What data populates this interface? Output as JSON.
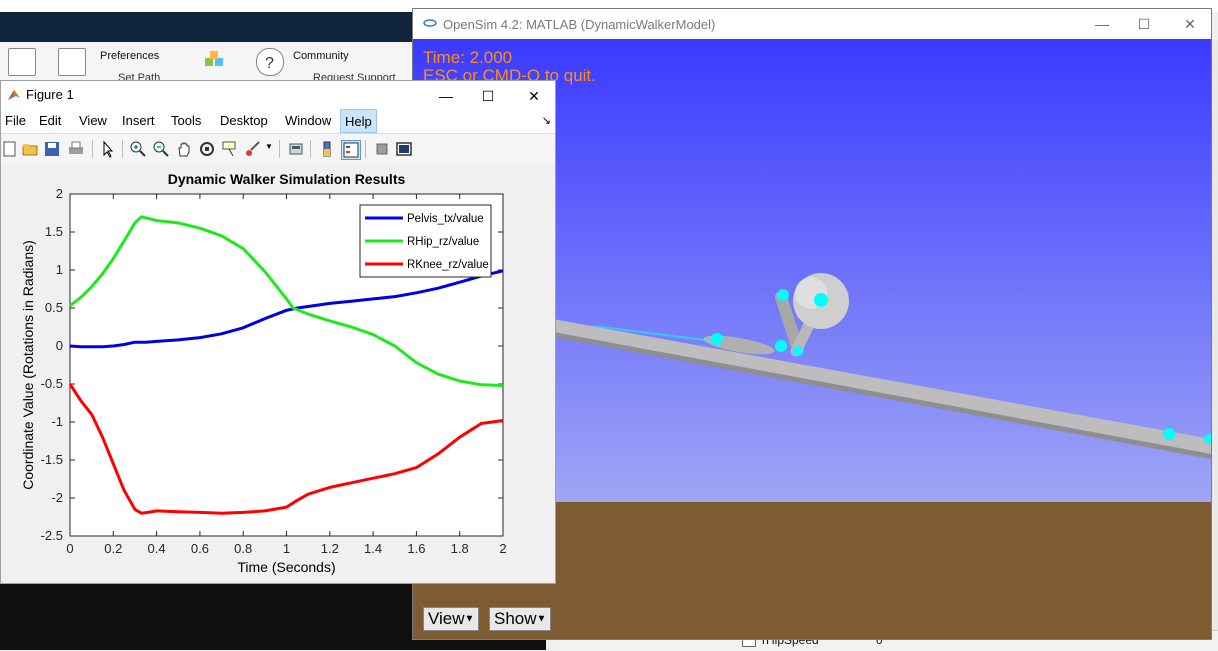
{
  "matlab_ribbon": {
    "preferences": "Preferences",
    "community": "Community",
    "set_path": "Set Path",
    "request_support": "Request Support"
  },
  "workspace": {
    "var_name": "rHipSpeed",
    "var_value": "0"
  },
  "opensim": {
    "title": "OpenSim 4.2: MATLAB (DynamicWalkerModel)",
    "time_text": "Time:  2.000",
    "quit_text": "ESC or CMD-Q to quit.",
    "view_button": "View",
    "show_button": "Show",
    "colors": {
      "sky_top": "#3a3aff",
      "ground": "#7d5c32",
      "marker": "#00ffff",
      "overlay_text": "#ff8c1a"
    }
  },
  "figure": {
    "title": "Figure 1",
    "menu": [
      "File",
      "Edit",
      "View",
      "Insert",
      "Tools",
      "Desktop",
      "Window",
      "Help"
    ],
    "active_menu": "Help",
    "toolbar_icons": [
      "new-file-icon",
      "open-file-icon",
      "save-icon",
      "print-icon",
      "select-arrow-icon",
      "zoom-in-icon",
      "zoom-out-icon",
      "pan-icon",
      "rotate-icon",
      "data-cursor-icon",
      "brush-icon",
      "link-icon",
      "colorbar-icon",
      "legend-icon",
      "hide-plot-tools-icon",
      "show-plot-tools-icon"
    ]
  },
  "chart_data": {
    "type": "line",
    "title": "Dynamic Walker Simulation Results",
    "xlabel": "Time (Seconds)",
    "ylabel": "Coordinate Value (Rotations in Radians)",
    "xlim": [
      0,
      2
    ],
    "ylim": [
      -2.5,
      2
    ],
    "xticks": [
      "0",
      "0.2",
      "0.4",
      "0.6",
      "0.8",
      "1",
      "1.2",
      "1.4",
      "1.6",
      "1.8",
      "2"
    ],
    "yticks": [
      "2",
      "1.5",
      "1",
      "0.5",
      "0",
      "-0.5",
      "-1",
      "-1.5",
      "-2",
      "-2.5"
    ],
    "legend_position": "top-right",
    "grid": false,
    "series": [
      {
        "name": "Pelvis_tx/value",
        "color": "#0000e6",
        "x": [
          0,
          0.05,
          0.1,
          0.15,
          0.2,
          0.25,
          0.3,
          0.35,
          0.4,
          0.5,
          0.6,
          0.7,
          0.8,
          0.9,
          1.0,
          1.05,
          1.1,
          1.2,
          1.3,
          1.4,
          1.5,
          1.6,
          1.7,
          1.8,
          1.9,
          2.0
        ],
        "y": [
          0.0,
          -0.01,
          -0.01,
          -0.01,
          0.0,
          0.02,
          0.05,
          0.05,
          0.06,
          0.08,
          0.11,
          0.16,
          0.24,
          0.36,
          0.47,
          0.5,
          0.52,
          0.56,
          0.59,
          0.62,
          0.65,
          0.7,
          0.76,
          0.84,
          0.92,
          0.99
        ]
      },
      {
        "name": "RHip_rz/value",
        "color": "#1ee81e",
        "x": [
          0,
          0.05,
          0.1,
          0.15,
          0.2,
          0.25,
          0.3,
          0.33,
          0.36,
          0.4,
          0.5,
          0.6,
          0.7,
          0.8,
          0.9,
          1.0,
          1.03,
          1.1,
          1.2,
          1.3,
          1.4,
          1.5,
          1.6,
          1.7,
          1.8,
          1.9,
          2.0
        ],
        "y": [
          0.53,
          0.64,
          0.78,
          0.95,
          1.15,
          1.38,
          1.62,
          1.7,
          1.68,
          1.65,
          1.62,
          1.55,
          1.45,
          1.28,
          0.98,
          0.62,
          0.5,
          0.42,
          0.33,
          0.25,
          0.15,
          0.0,
          -0.22,
          -0.37,
          -0.46,
          -0.51,
          -0.52
        ]
      },
      {
        "name": "RKnee_rz/value",
        "color": "#ff0000",
        "x": [
          0,
          0.05,
          0.1,
          0.15,
          0.2,
          0.25,
          0.3,
          0.33,
          0.36,
          0.4,
          0.5,
          0.6,
          0.7,
          0.8,
          0.9,
          1.0,
          1.05,
          1.1,
          1.2,
          1.3,
          1.4,
          1.5,
          1.6,
          1.7,
          1.8,
          1.9,
          2.0
        ],
        "y": [
          -0.5,
          -0.72,
          -0.9,
          -1.2,
          -1.55,
          -1.9,
          -2.15,
          -2.2,
          -2.19,
          -2.17,
          -2.18,
          -2.19,
          -2.2,
          -2.19,
          -2.17,
          -2.12,
          -2.03,
          -1.95,
          -1.86,
          -1.8,
          -1.74,
          -1.68,
          -1.6,
          -1.42,
          -1.2,
          -1.02,
          -0.98
        ]
      }
    ]
  }
}
